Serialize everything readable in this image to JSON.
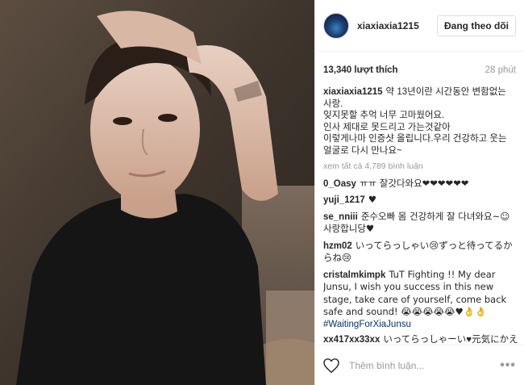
{
  "post": {
    "image_alt": "photo"
  },
  "header": {
    "username": "xiaxiaxia1215",
    "follow_label": "Đang theo dõi"
  },
  "meta": {
    "likes": "13,340 lượt thích",
    "time": "28 phút"
  },
  "caption": {
    "username": "xiaxiaxia1215",
    "line1": "약 13년이란 시간동안 변함없는",
    "line2": "사랑.",
    "line3": "잊지못할 추억 너무 고마웠어요.",
    "line4": "인사 제대로 못드리고 가는것같아",
    "line5": "이렇게나마 인증샷 올립니다.우리 건강하고 웃는",
    "line6": "얼굴로 다시 만나요~"
  },
  "view_all": "xem tất cả 4,789 bình luận",
  "comments": [
    {
      "user": "0_Oasy",
      "text": "ㅠㅠ 잘갓다와요❤❤❤❤❤❤"
    },
    {
      "user": "yuji_1217",
      "text": "♥"
    },
    {
      "user": "se_nniii",
      "text": "준수오빠 몸 건강하게 잘 다녀와요~☺ 사랑합니당♥"
    },
    {
      "user": "hzm02",
      "text": "いってらっしゃい😢ずっと待ってるからね😢"
    },
    {
      "user": "cristalmkimpk",
      "text": "TuT Fighting !! My dear Junsu, I wish you success in this new stage, take care of yourself, come back safe and sound! 😭😭😭😭😭♥👌👌"
    },
    {
      "user": "",
      "text": "#WaitingForXiaJunsu"
    },
    {
      "user": "xx417xx33xx",
      "text": "いってらっしゃーい♥元気にかえ"
    }
  ],
  "footer": {
    "add_comment_placeholder": "Thêm bình luận...",
    "more_label": "•••"
  },
  "colors": {
    "link": "#003569",
    "muted": "#999999",
    "border": "#efefef"
  }
}
